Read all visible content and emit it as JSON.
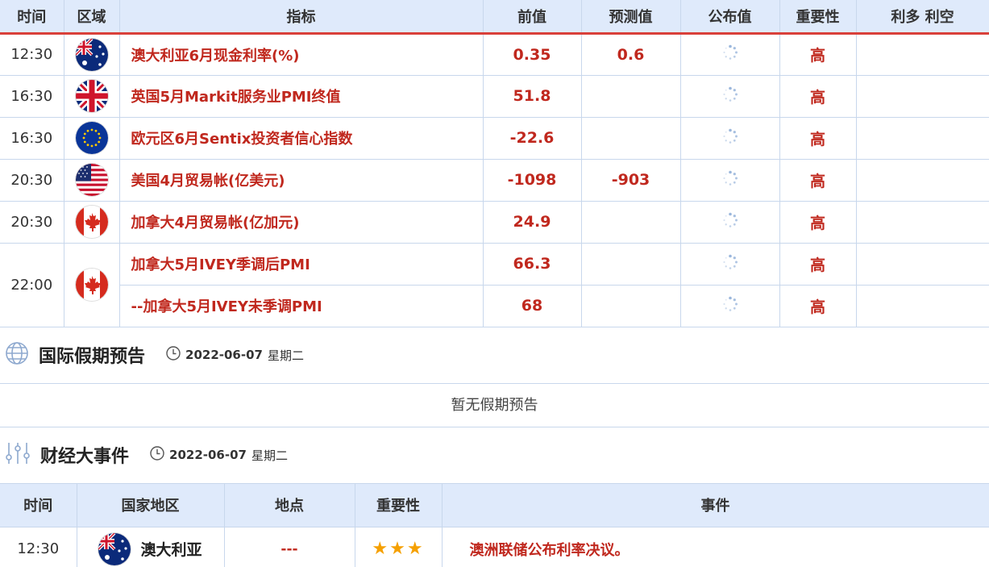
{
  "calendar": {
    "headers": [
      "时间",
      "区域",
      "指标",
      "前值",
      "预测值",
      "公布值",
      "重要性",
      "利多 利空"
    ],
    "rows": [
      {
        "time": "12:30",
        "flag": "australia-flag-icon",
        "indicator": "澳大利亚6月现金利率(%)",
        "previous": "0.35",
        "forecast": "0.6",
        "importance": "高"
      },
      {
        "time": "16:30",
        "flag": "uk-flag-icon",
        "indicator": "英国5月Markit服务业PMI终值",
        "previous": "51.8",
        "forecast": "",
        "importance": "高"
      },
      {
        "time": "16:30",
        "flag": "eu-flag-icon",
        "indicator": "欧元区6月Sentix投资者信心指数",
        "previous": "-22.6",
        "forecast": "",
        "importance": "高"
      },
      {
        "time": "20:30",
        "flag": "us-flag-icon",
        "indicator": "美国4月贸易帐(亿美元)",
        "previous": "-1098",
        "forecast": "-903",
        "importance": "高"
      },
      {
        "time": "20:30",
        "flag": "canada-flag-icon",
        "indicator": "加拿大4月贸易帐(亿加元)",
        "previous": "24.9",
        "forecast": "",
        "importance": "高"
      },
      {
        "time": "22:00",
        "flag": "canada-flag-icon",
        "indicator": "加拿大5月IVEY季调后PMI",
        "previous": "66.3",
        "forecast": "",
        "importance": "高"
      },
      {
        "time": "",
        "flag": "",
        "indicator": "--加拿大5月IVEY未季调PMI",
        "previous": "68",
        "forecast": "",
        "importance": "高"
      }
    ]
  },
  "holidays": {
    "title": "国际假期预告",
    "date": "2022-06-07",
    "weekday": "星期二",
    "empty_text": "暂无假期预告"
  },
  "events": {
    "title": "财经大事件",
    "date": "2022-06-07",
    "weekday": "星期二",
    "headers": [
      "时间",
      "国家地区",
      "地点",
      "重要性",
      "事件"
    ],
    "rows": [
      {
        "time": "12:30",
        "country": "澳大利亚",
        "location": "---",
        "stars": "★★★",
        "event": "澳洲联储公布利率决议。"
      }
    ]
  },
  "colors": {
    "accent_red": "#c0281e",
    "header_bg": "#dfeafb",
    "star": "#f5a000"
  }
}
